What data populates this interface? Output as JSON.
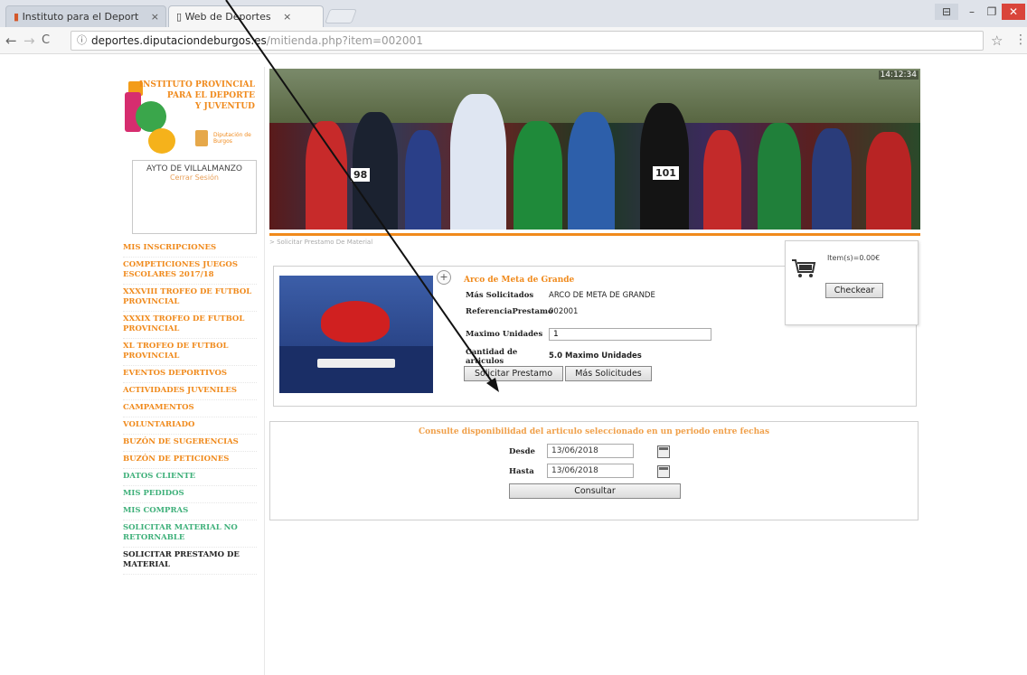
{
  "browser": {
    "tabs": [
      {
        "title": "Instituto para el Deport",
        "close": "×"
      },
      {
        "title": "Web de Deportes",
        "close": "×"
      }
    ],
    "window_controls": {
      "minimize": "–",
      "maximize": "❐",
      "close": "✕"
    },
    "nav": {
      "back": "←",
      "forward": "→",
      "reload": "C"
    },
    "address": {
      "domain": "deportes.diputaciondeburgos.es",
      "path": "/mitienda.php?item=002001"
    },
    "bookmark": "☆",
    "menu": "⋮"
  },
  "site": {
    "logo_lines": [
      "INSTITUTO PROVINCIAL",
      "PARA EL DEPORTE",
      "Y JUVENTUD"
    ],
    "logo_sub": "Diputación de Burgos",
    "user": {
      "name": "AYTO DE VILLALMANZO",
      "sub": "Cerrar Sesión"
    },
    "clock": "14:12:34",
    "breadcrumb": "> Solicitar Prestamo De Material",
    "menu": [
      {
        "label": "MIS INSCRIPCIONES",
        "style": "orange"
      },
      {
        "label": "COMPETICIONES JUEGOS ESCOLARES 2017/18",
        "style": "orange"
      },
      {
        "label": "XXXVIII TROFEO DE FUTBOL PROVINCIAL",
        "style": "orange"
      },
      {
        "label": "XXXIX TROFEO DE FUTBOL PROVINCIAL",
        "style": "orange"
      },
      {
        "label": "XL TROFEO DE FUTBOL PROVINCIAL",
        "style": "orange"
      },
      {
        "label": "EVENTOS DEPORTIVOS",
        "style": "orange"
      },
      {
        "label": "ACTIVIDADES JUVENILES",
        "style": "orange"
      },
      {
        "label": "CAMPAMENTOS",
        "style": "orange"
      },
      {
        "label": "VOLUNTARIADO",
        "style": "orange"
      },
      {
        "label": "BUZÓN DE SUGERENCIAS",
        "style": "orange"
      },
      {
        "label": "BUZÓN DE PETICIONES",
        "style": "orange"
      },
      {
        "label": "DATOS CLIENTE",
        "style": "green"
      },
      {
        "label": "MIS PEDIDOS",
        "style": "green"
      },
      {
        "label": "MIS COMPRAS",
        "style": "green"
      },
      {
        "label": "SOLICITAR MATERIAL NO RETORNABLE",
        "style": "green"
      },
      {
        "label": "SOLICITAR PRESTAMO DE MATERIAL",
        "style": "black"
      }
    ],
    "bibs": [
      "98",
      "101"
    ]
  },
  "product": {
    "title": "Arco de Meta de Grande",
    "rows": [
      {
        "key": "Más Solicitados",
        "value": "ARCO DE META DE GRANDE"
      },
      {
        "key": "ReferenciaPrestamo",
        "value": "002001"
      },
      {
        "key": "Maximo Unidades",
        "value": ""
      },
      {
        "key": "Cantidad de articulos",
        "value": "5.0 Maximo Unidades"
      }
    ],
    "quantity": "1",
    "request_button": "Solicitar Prestamo",
    "most_requested_button": "Más Solicitudes",
    "zoom_icon": "+"
  },
  "cart": {
    "items": "Item(s)=0.00€",
    "checkout_button": "Checkear"
  },
  "availability": {
    "title": "Consulte disponibilidad del articulo seleccionado en un periodo entre fechas",
    "from_label": "Desde",
    "from_value": "13/06/2018",
    "to_label": "Hasta",
    "to_value": "13/06/2018",
    "submit": "Consultar"
  },
  "colors": {
    "accent": "#f08a1c",
    "green": "#3fb07a"
  }
}
